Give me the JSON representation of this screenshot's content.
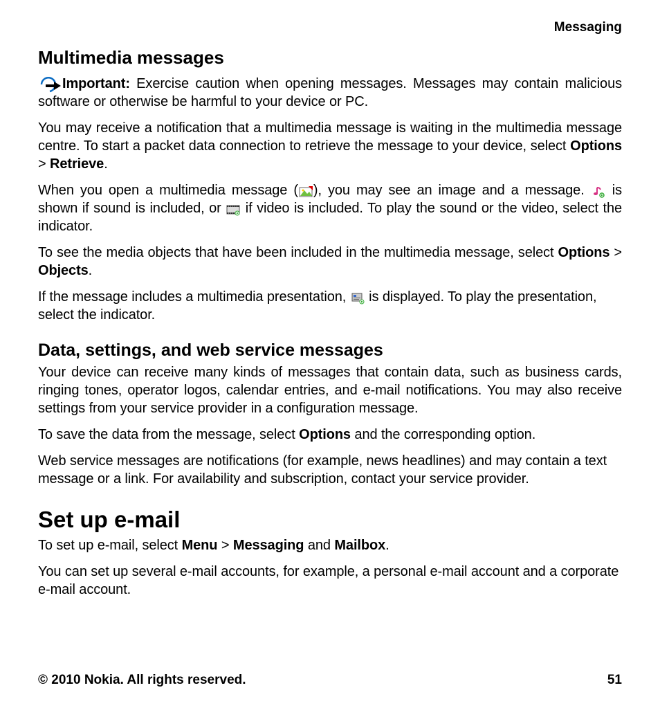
{
  "header": {
    "category": "Messaging"
  },
  "section1": {
    "title": "Multimedia messages",
    "important_label": "Important:",
    "important_text": " Exercise caution when opening messages. Messages may contain malicious software or otherwise be harmful to your device or PC.",
    "p2a": "You may receive a notification that a multimedia message is waiting in the multimedia message centre. To start a packet data connection to retrieve the message to your device, select ",
    "p2_opt": "Options",
    "p2_gt": " > ",
    "p2_retrieve": "Retrieve",
    "p2_end": ".",
    "p3a": "When you open a multimedia message (",
    "p3b": "), you may see an image and a message. ",
    "p3c": " is shown if sound is included, or ",
    "p3d": " if video is included. To play the sound or the video, select the indicator.",
    "p4a": "To see the media objects that have been included in the multimedia message, select ",
    "p4_opt": "Options",
    "p4_gt": " > ",
    "p4_obj": "Objects",
    "p4_end": ".",
    "p5a": "If the message includes a multimedia presentation, ",
    "p5b": " is displayed. To play the presentation, select the indicator."
  },
  "section2": {
    "title": "Data, settings, and web service messages",
    "p1": "Your device can receive many kinds of messages that contain data, such as business cards, ringing tones, operator logos, calendar entries, and e-mail notifications. You may also receive settings from your service provider in a configuration message.",
    "p2a": "To save the data from the message, select ",
    "p2_opt": "Options",
    "p2b": " and the corresponding option.",
    "p3": "Web service messages are notifications (for example, news headlines) and may contain a text message or a link. For availability and subscription, contact your service provider."
  },
  "section3": {
    "title": "Set up e-mail",
    "p1a": "To set up e-mail, select ",
    "p1_menu": "Menu",
    "p1_gt": " > ",
    "p1_msg": "Messaging",
    "p1_and": " and ",
    "p1_mbox": "Mailbox",
    "p1_end": ".",
    "p2": "You can set up several e-mail accounts, for example, a personal e-mail account and a corporate e-mail account."
  },
  "footer": {
    "copyright": "© 2010 Nokia. All rights reserved.",
    "page": "51"
  }
}
